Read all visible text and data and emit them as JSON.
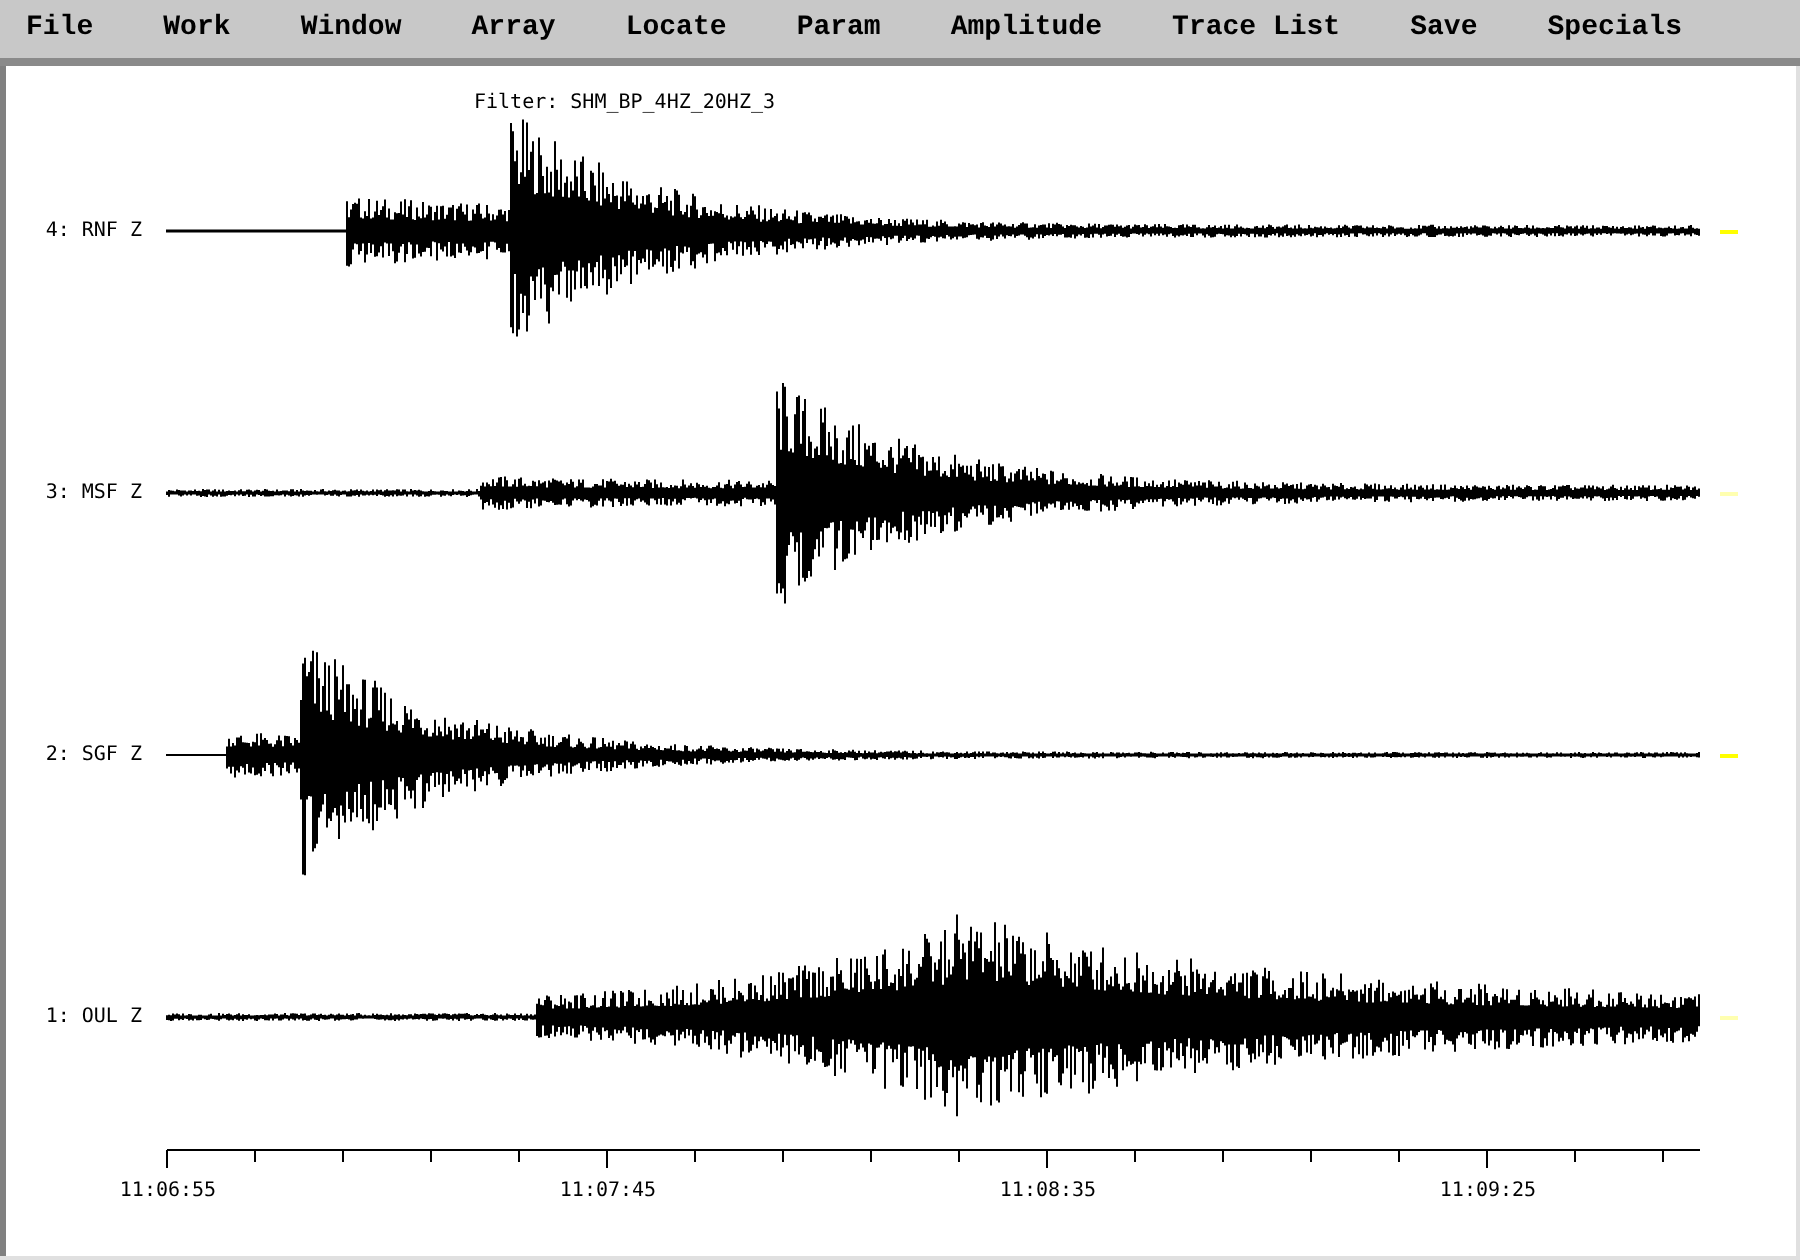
{
  "menu": [
    "File",
    "Work",
    "Window",
    "Array",
    "Locate",
    "Param",
    "Amplitude",
    "Trace List",
    "Save",
    "Specials"
  ],
  "filter": "Filter: SHM_BP_4HZ_20HZ_3",
  "traces": [
    {
      "label": "4: RNF Z",
      "color": "#ffff00"
    },
    {
      "label": "3: MSF Z",
      "color": "#ffffb0"
    },
    {
      "label": "2: SGF Z",
      "color": "#ffff00"
    },
    {
      "label": "1: OUL Z",
      "color": "#ffffb0"
    }
  ],
  "time_axis": {
    "labels": [
      "11:06:55",
      "11:07:45",
      "11:08:35",
      "11:09:25"
    ]
  }
}
